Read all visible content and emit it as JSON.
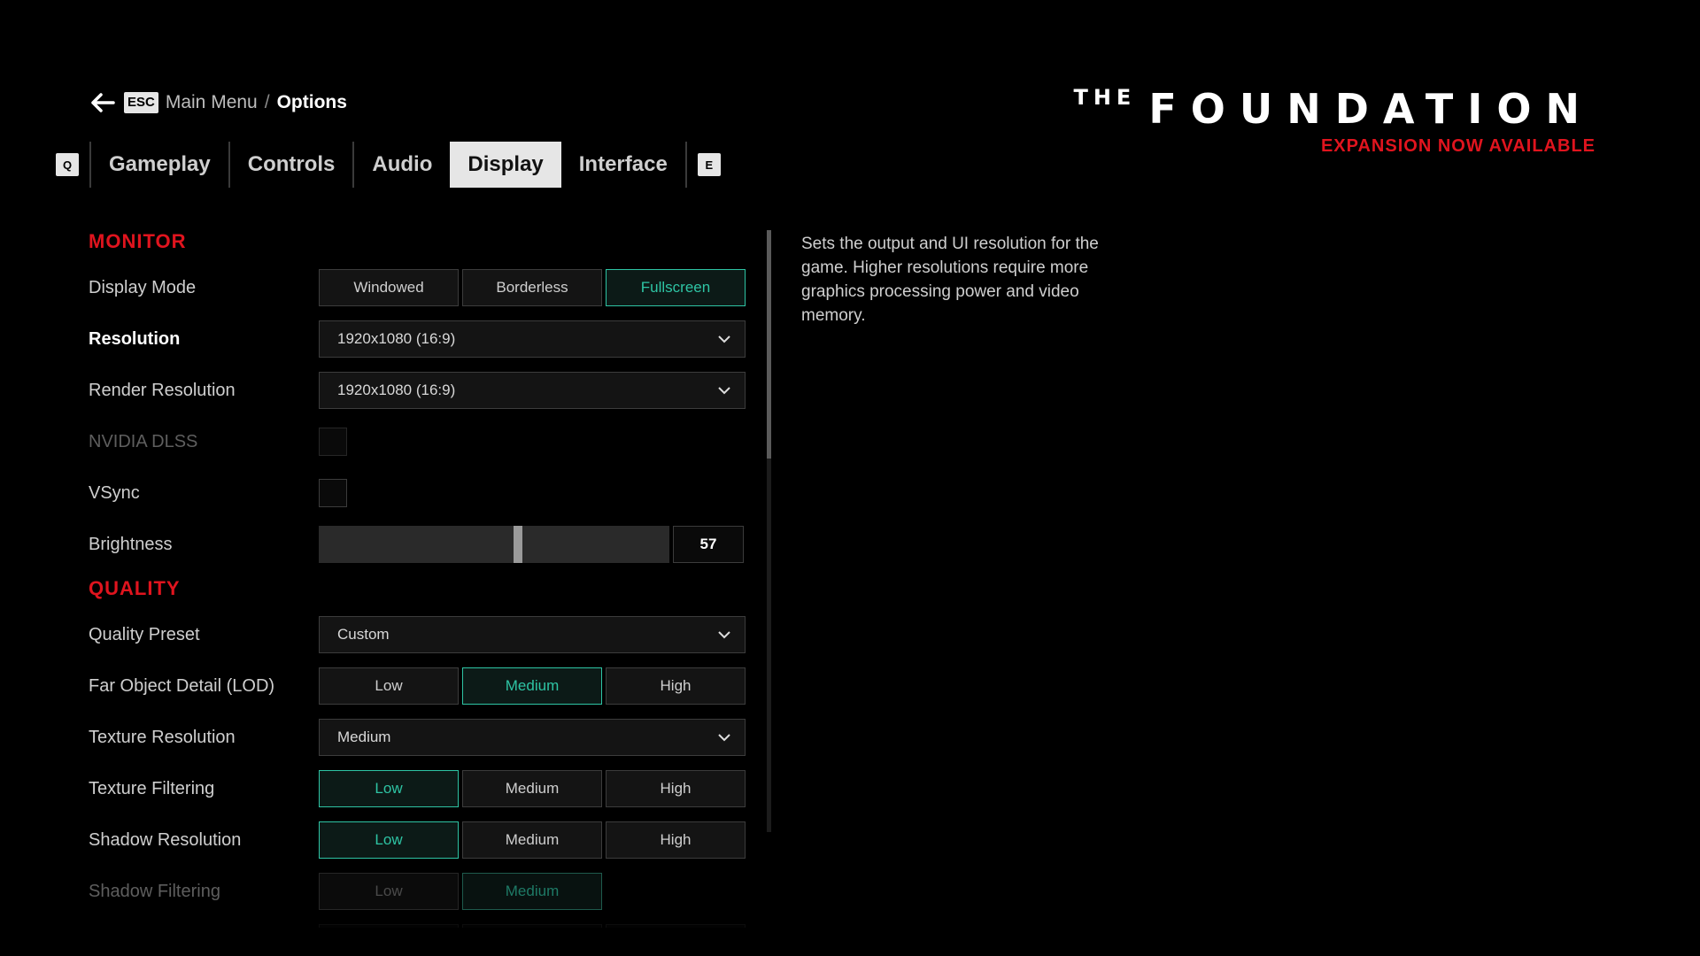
{
  "breadcrumb": {
    "esc_key": "ESC",
    "parent": "Main Menu",
    "separator": "/",
    "current": "Options"
  },
  "tabs": {
    "prev_key": "Q",
    "next_key": "E",
    "items": [
      {
        "label": "Gameplay",
        "active": false
      },
      {
        "label": "Controls",
        "active": false
      },
      {
        "label": "Audio",
        "active": false
      },
      {
        "label": "Display",
        "active": true
      },
      {
        "label": "Interface",
        "active": false
      }
    ]
  },
  "logo": {
    "the": "THE",
    "title": "FOUNDATION",
    "subtitle": "EXPANSION NOW AVAILABLE"
  },
  "sections": {
    "monitor": "MONITOR",
    "quality": "QUALITY"
  },
  "settings": {
    "display_mode": {
      "label": "Display Mode",
      "options": [
        "Windowed",
        "Borderless",
        "Fullscreen"
      ],
      "selected": "Fullscreen"
    },
    "resolution": {
      "label": "Resolution",
      "value": "1920x1080 (16:9)"
    },
    "render_resolution": {
      "label": "Render Resolution",
      "value": "1920x1080 (16:9)"
    },
    "nvidia_dlss": {
      "label": "NVIDIA DLSS",
      "checked": false,
      "disabled": true
    },
    "vsync": {
      "label": "VSync",
      "checked": false
    },
    "brightness": {
      "label": "Brightness",
      "value": "57",
      "fraction": 0.57
    },
    "quality_preset": {
      "label": "Quality Preset",
      "value": "Custom"
    },
    "far_object_detail": {
      "label": "Far Object Detail (LOD)",
      "options": [
        "Low",
        "Medium",
        "High"
      ],
      "selected": "Medium"
    },
    "texture_resolution": {
      "label": "Texture Resolution",
      "value": "Medium"
    },
    "texture_filtering": {
      "label": "Texture Filtering",
      "options": [
        "Low",
        "Medium",
        "High"
      ],
      "selected": "Low"
    },
    "shadow_resolution": {
      "label": "Shadow Resolution",
      "options": [
        "Low",
        "Medium",
        "High"
      ],
      "selected": "Low"
    },
    "shadow_filtering": {
      "label": "Shadow Filtering",
      "options": [
        "Low",
        "Medium"
      ],
      "selected": "Medium",
      "disabled": true
    }
  },
  "description": "Sets the output and UI resolution for the game. Higher resolutions require more graphics processing power and video memory.",
  "colors": {
    "accent_red": "#e0141e",
    "selected_teal": "#2ec4a4",
    "background": "#000000"
  }
}
